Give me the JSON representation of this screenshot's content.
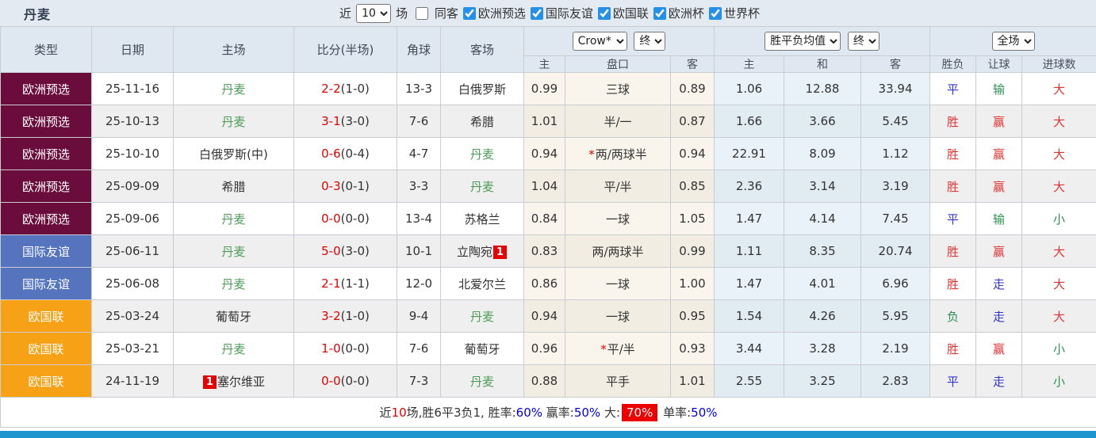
{
  "title": "丹麦",
  "topbar": {
    "recent_label": "近",
    "recent_value": "10",
    "games_label": "场",
    "same_label": "同客",
    "same_checked": false,
    "filters": [
      {
        "label": "欧洲预选",
        "checked": true
      },
      {
        "label": "国际友谊",
        "checked": true
      },
      {
        "label": "欧国联",
        "checked": true
      },
      {
        "label": "欧洲杯",
        "checked": true
      },
      {
        "label": "世界杯",
        "checked": true
      }
    ]
  },
  "header": {
    "cols": [
      "类型",
      "日期",
      "主场",
      "比分(半场)",
      "角球",
      "客场"
    ],
    "odds_company": "Crow*",
    "odds_time": "终",
    "avg_type": "胜平负均值",
    "avg_time": "终",
    "scope": "全场",
    "sub": [
      "主",
      "盘口",
      "客",
      "主",
      "和",
      "客",
      "胜负",
      "让球",
      "进球数"
    ]
  },
  "rows": [
    {
      "type": "欧洲预选",
      "type_color": "maroon",
      "date": "25-11-16",
      "home": "丹麦",
      "home_dk": true,
      "home_badge": "",
      "score": "2-2",
      "half": "(1-0)",
      "corner": "13-3",
      "away": "白俄罗斯",
      "away_dk": false,
      "away_badge": "",
      "odds_home": "0.99",
      "handicap": "三球",
      "star": false,
      "odds_away": "0.89",
      "avg_home": "1.06",
      "avg_draw": "12.88",
      "avg_away": "33.94",
      "result": "平",
      "result_c": "blue",
      "handicap_result": "输",
      "handicap_result_c": "green",
      "goals": "大",
      "goals_c": "red"
    },
    {
      "type": "欧洲预选",
      "type_color": "maroon",
      "date": "25-10-13",
      "home": "丹麦",
      "home_dk": true,
      "home_badge": "",
      "score": "3-1",
      "half": "(3-0)",
      "corner": "7-6",
      "away": "希腊",
      "away_dk": false,
      "away_badge": "",
      "odds_home": "1.01",
      "handicap": "半/一",
      "star": false,
      "odds_away": "0.87",
      "avg_home": "1.66",
      "avg_draw": "3.66",
      "avg_away": "5.45",
      "result": "胜",
      "result_c": "red",
      "handicap_result": "赢",
      "handicap_result_c": "red",
      "goals": "大",
      "goals_c": "red"
    },
    {
      "type": "欧洲预选",
      "type_color": "maroon",
      "date": "25-10-10",
      "home": "白俄罗斯(中)",
      "home_dk": false,
      "home_badge": "",
      "score": "0-6",
      "half": "(0-4)",
      "corner": "4-7",
      "away": "丹麦",
      "away_dk": true,
      "away_badge": "",
      "odds_home": "0.94",
      "handicap": "两/两球半",
      "star": true,
      "odds_away": "0.94",
      "avg_home": "22.91",
      "avg_draw": "8.09",
      "avg_away": "1.12",
      "result": "胜",
      "result_c": "red",
      "handicap_result": "赢",
      "handicap_result_c": "red",
      "goals": "大",
      "goals_c": "red"
    },
    {
      "type": "欧洲预选",
      "type_color": "maroon",
      "date": "25-09-09",
      "home": "希腊",
      "home_dk": false,
      "home_badge": "",
      "score": "0-3",
      "half": "(0-1)",
      "corner": "3-3",
      "away": "丹麦",
      "away_dk": true,
      "away_badge": "",
      "odds_home": "1.04",
      "handicap": "平/半",
      "star": false,
      "odds_away": "0.85",
      "avg_home": "2.36",
      "avg_draw": "3.14",
      "avg_away": "3.19",
      "result": "胜",
      "result_c": "red",
      "handicap_result": "赢",
      "handicap_result_c": "red",
      "goals": "大",
      "goals_c": "red"
    },
    {
      "type": "欧洲预选",
      "type_color": "maroon",
      "date": "25-09-06",
      "home": "丹麦",
      "home_dk": true,
      "home_badge": "",
      "score": "0-0",
      "half": "(0-0)",
      "corner": "13-4",
      "away": "苏格兰",
      "away_dk": false,
      "away_badge": "",
      "odds_home": "0.84",
      "handicap": "一球",
      "star": false,
      "odds_away": "1.05",
      "avg_home": "1.47",
      "avg_draw": "4.14",
      "avg_away": "7.45",
      "result": "平",
      "result_c": "blue",
      "handicap_result": "输",
      "handicap_result_c": "green",
      "goals": "小",
      "goals_c": "green"
    },
    {
      "type": "国际友谊",
      "type_color": "blue",
      "date": "25-06-11",
      "home": "丹麦",
      "home_dk": true,
      "home_badge": "",
      "score": "5-0",
      "half": "(3-0)",
      "corner": "10-1",
      "away": "立陶宛",
      "away_dk": false,
      "away_badge": "1",
      "odds_home": "0.83",
      "handicap": "两/两球半",
      "star": false,
      "odds_away": "0.99",
      "avg_home": "1.11",
      "avg_draw": "8.35",
      "avg_away": "20.74",
      "result": "胜",
      "result_c": "red",
      "handicap_result": "赢",
      "handicap_result_c": "red",
      "goals": "大",
      "goals_c": "red"
    },
    {
      "type": "国际友谊",
      "type_color": "blue",
      "date": "25-06-08",
      "home": "丹麦",
      "home_dk": true,
      "home_badge": "",
      "score": "2-1",
      "half": "(1-1)",
      "corner": "12-0",
      "away": "北爱尔兰",
      "away_dk": false,
      "away_badge": "",
      "odds_home": "0.86",
      "handicap": "一球",
      "star": false,
      "odds_away": "1.00",
      "avg_home": "1.47",
      "avg_draw": "4.01",
      "avg_away": "6.96",
      "result": "胜",
      "result_c": "red",
      "handicap_result": "走",
      "handicap_result_c": "blue",
      "goals": "大",
      "goals_c": "red"
    },
    {
      "type": "欧国联",
      "type_color": "orange",
      "date": "25-03-24",
      "home": "葡萄牙",
      "home_dk": false,
      "home_badge": "",
      "score": "3-2",
      "half": "(1-0)",
      "corner": "9-4",
      "away": "丹麦",
      "away_dk": true,
      "away_badge": "",
      "odds_home": "0.94",
      "handicap": "一球",
      "star": false,
      "odds_away": "0.95",
      "avg_home": "1.54",
      "avg_draw": "4.26",
      "avg_away": "5.95",
      "result": "负",
      "result_c": "green",
      "handicap_result": "走",
      "handicap_result_c": "blue",
      "goals": "大",
      "goals_c": "red"
    },
    {
      "type": "欧国联",
      "type_color": "orange",
      "date": "25-03-21",
      "home": "丹麦",
      "home_dk": true,
      "home_badge": "",
      "score": "1-0",
      "half": "(0-0)",
      "corner": "7-6",
      "away": "葡萄牙",
      "away_dk": false,
      "away_badge": "",
      "odds_home": "0.96",
      "handicap": "平/半",
      "star": true,
      "odds_away": "0.93",
      "avg_home": "3.44",
      "avg_draw": "3.28",
      "avg_away": "2.19",
      "result": "胜",
      "result_c": "red",
      "handicap_result": "赢",
      "handicap_result_c": "red",
      "goals": "小",
      "goals_c": "green"
    },
    {
      "type": "欧国联",
      "type_color": "orange",
      "date": "24-11-19",
      "home": "塞尔维亚",
      "home_dk": false,
      "home_badge": "1",
      "score": "0-0",
      "half": "(0-0)",
      "corner": "7-3",
      "away": "丹麦",
      "away_dk": true,
      "away_badge": "",
      "odds_home": "0.88",
      "handicap": "平手",
      "star": false,
      "odds_away": "1.01",
      "avg_home": "2.55",
      "avg_draw": "3.25",
      "avg_away": "2.83",
      "result": "平",
      "result_c": "blue",
      "handicap_result": "走",
      "handicap_result_c": "blue",
      "goals": "小",
      "goals_c": "green"
    }
  ],
  "summary": {
    "segments": [
      {
        "text": "近",
        "style": "dark"
      },
      {
        "text": "10",
        "style": "red"
      },
      {
        "text": "场,胜6平3负1, 胜率:",
        "style": "dark"
      },
      {
        "text": "60%",
        "style": "blue"
      },
      {
        "text": " 赢率:",
        "style": "dark"
      },
      {
        "text": "50%",
        "style": "blue"
      },
      {
        "text": " 大:",
        "style": "dark"
      },
      {
        "text": "70%",
        "style": "redbox"
      },
      {
        "text": " 单率:",
        "style": "dark"
      },
      {
        "text": "50%",
        "style": "blue"
      }
    ]
  },
  "colors": {
    "type": {
      "maroon": "#6a0d3c",
      "blue": "#5574bd",
      "orange": "#f7a117"
    },
    "score_red": "#e60000",
    "team_green": "#4f9d58",
    "win_red": "#e13434",
    "draw_blue": "#3434cf",
    "loss_green": "#2e9152",
    "accent_bar": "#1e95cf",
    "checkbox_blue": "#2590e9"
  }
}
